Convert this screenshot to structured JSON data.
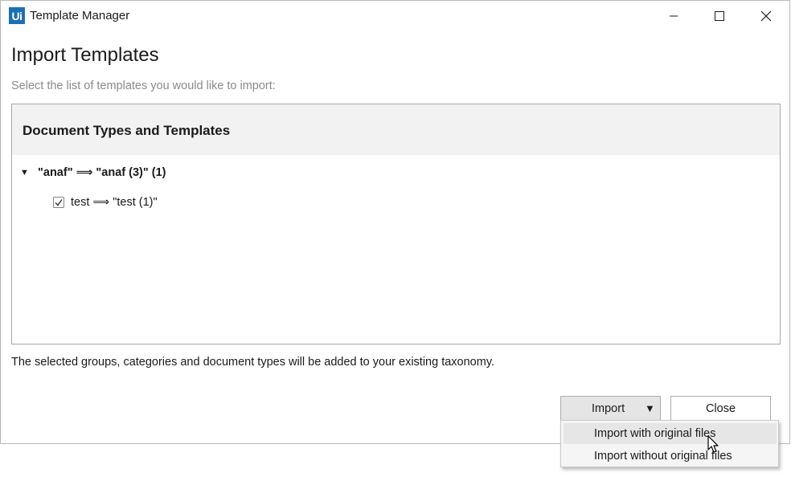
{
  "window": {
    "app_icon_text": "Ui",
    "title": "Template Manager",
    "controls": [
      "minimize-icon",
      "maximize-icon",
      "close-icon"
    ]
  },
  "page": {
    "heading": "Import Templates",
    "subtitle": "Select the list of templates you would like to import:"
  },
  "panel": {
    "header": "Document Types and Templates",
    "tree": [
      {
        "label": "\"anaf\" ⟹ \"anaf (3)\" (1)",
        "expanded": true,
        "children": [
          {
            "label": "test ⟹ \"test (1)\"",
            "checked": true
          }
        ]
      }
    ]
  },
  "footer_note": "The selected groups, categories and document types will be added to your existing taxonomy.",
  "buttons": {
    "import": "Import",
    "close": "Close"
  },
  "import_menu": {
    "items": [
      "Import with original files",
      "Import without original files"
    ],
    "highlighted": "Import with original files"
  },
  "colors": {
    "brand": "#1d6fb5",
    "panel_header_bg": "#f2f2f2",
    "subtitle": "#8a8a8a",
    "import_button_bg": "#e5e5e5"
  }
}
